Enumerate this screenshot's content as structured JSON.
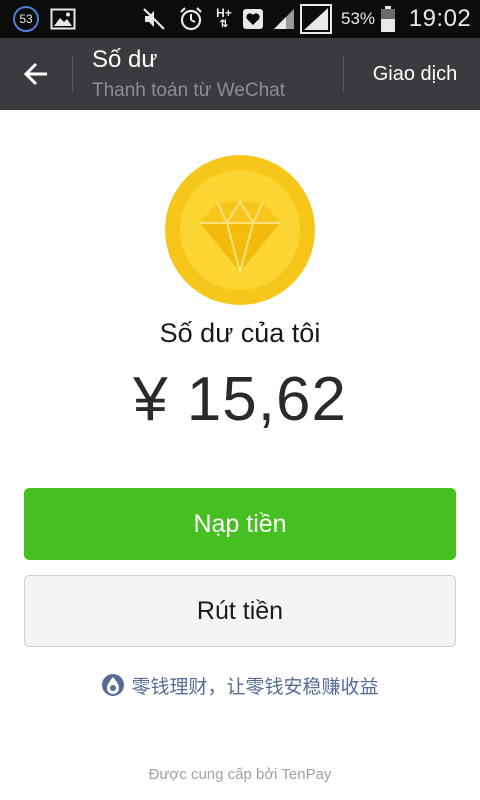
{
  "status_bar": {
    "notification_count": "53",
    "network_type": "H+",
    "battery_percent": "53%",
    "time": "19:02",
    "icons": [
      "notification-badge-icon",
      "gallery-icon",
      "mute-icon",
      "alarm-icon",
      "network-h-plus-icon",
      "heart-icon",
      "signal-icon",
      "signal-icon",
      "battery-icon"
    ]
  },
  "action_bar": {
    "back_icon": "arrow-left-icon",
    "title": "Số dư",
    "subtitle": "Thanh toán từ WeChat",
    "transactions_label": "Giao dịch"
  },
  "balance": {
    "coin_icon": "diamond-coin-icon",
    "label": "Số dư của tôi",
    "amount": "¥ 15,62"
  },
  "buttons": {
    "top_up_label": "Nạp tiền",
    "withdraw_label": "Rút tiền"
  },
  "promo": {
    "icon": "licaitong-icon",
    "text": "零钱理财，让零钱安稳赚收益"
  },
  "footer": {
    "text": "Được cung cấp bởi TenPay"
  },
  "colors": {
    "action_bar_bg": "#3a3a3f",
    "status_bar_bg": "#0c0c0c",
    "primary_green": "#46c021",
    "coin_outer": "#f7c61a",
    "coin_inner": "#fcd533",
    "link_blue": "#576b95"
  }
}
